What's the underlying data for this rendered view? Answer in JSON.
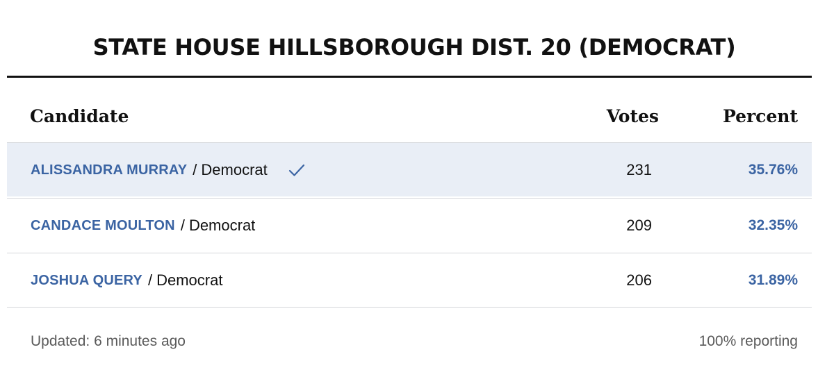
{
  "title": "STATE HOUSE HILLSBOROUGH DIST. 20 (DEMOCRAT)",
  "columns": {
    "candidate": "Candidate",
    "votes": "Votes",
    "percent": "Percent"
  },
  "rows": [
    {
      "name": "ALISSANDRA MURRAY",
      "separator": "/",
      "party": "Democrat",
      "votes": "231",
      "percent": "35.76%",
      "winner": true
    },
    {
      "name": "CANDACE MOULTON",
      "separator": "/",
      "party": "Democrat",
      "votes": "209",
      "percent": "32.35%",
      "winner": false
    },
    {
      "name": "JOSHUA QUERY",
      "separator": "/",
      "party": "Democrat",
      "votes": "206",
      "percent": "31.89%",
      "winner": false
    }
  ],
  "footer": {
    "updated": "Updated: 6 minutes ago",
    "reporting": "100% reporting"
  },
  "icons": {
    "winner": "checkmark-icon"
  },
  "colors": {
    "candidate_name": "#3b64a3",
    "percent": "#3b64a3",
    "winner_row_bg": "#e9eef6",
    "checkmark": "#3b64a3"
  }
}
